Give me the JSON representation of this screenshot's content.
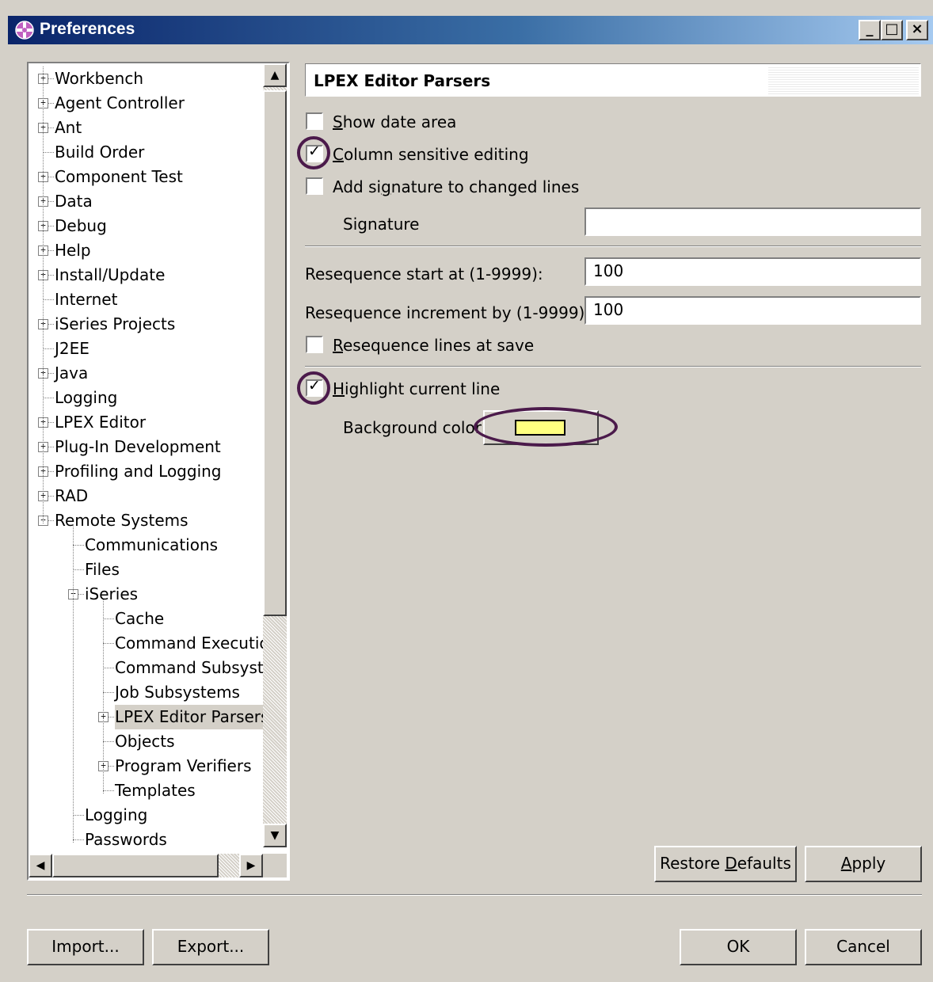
{
  "window": {
    "title": "Preferences",
    "controls": [
      "_",
      "□",
      "×"
    ]
  },
  "tree": {
    "items": [
      {
        "label": "Workbench",
        "expander": "+",
        "level": 0
      },
      {
        "label": "Agent Controller",
        "expander": "+",
        "level": 0
      },
      {
        "label": "Ant",
        "expander": "+",
        "level": 0
      },
      {
        "label": "Build Order",
        "expander": "",
        "level": 0
      },
      {
        "label": "Component Test",
        "expander": "+",
        "level": 0
      },
      {
        "label": "Data",
        "expander": "+",
        "level": 0
      },
      {
        "label": "Debug",
        "expander": "+",
        "level": 0
      },
      {
        "label": "Help",
        "expander": "+",
        "level": 0
      },
      {
        "label": "Install/Update",
        "expander": "+",
        "level": 0
      },
      {
        "label": "Internet",
        "expander": "",
        "level": 0
      },
      {
        "label": "iSeries Projects",
        "expander": "+",
        "level": 0
      },
      {
        "label": "J2EE",
        "expander": "",
        "level": 0
      },
      {
        "label": "Java",
        "expander": "+",
        "level": 0
      },
      {
        "label": "Logging",
        "expander": "",
        "level": 0
      },
      {
        "label": "LPEX Editor",
        "expander": "+",
        "level": 0
      },
      {
        "label": "Plug-In Development",
        "expander": "+",
        "level": 0
      },
      {
        "label": "Profiling and Logging",
        "expander": "+",
        "level": 0
      },
      {
        "label": "RAD",
        "expander": "+",
        "level": 0
      },
      {
        "label": "Remote Systems",
        "expander": "−",
        "level": 0
      },
      {
        "label": "Communications",
        "expander": "",
        "level": 1
      },
      {
        "label": "Files",
        "expander": "",
        "level": 1
      },
      {
        "label": "iSeries",
        "expander": "−",
        "level": 1
      },
      {
        "label": "Cache",
        "expander": "",
        "level": 2
      },
      {
        "label": "Command Executio",
        "expander": "",
        "level": 2
      },
      {
        "label": "Command Subsyste",
        "expander": "",
        "level": 2
      },
      {
        "label": "Job Subsystems",
        "expander": "",
        "level": 2
      },
      {
        "label": "LPEX Editor Parsers",
        "expander": "+",
        "level": 2,
        "selected": true
      },
      {
        "label": "Objects",
        "expander": "",
        "level": 2
      },
      {
        "label": "Program Verifiers",
        "expander": "+",
        "level": 2
      },
      {
        "label": "Templates",
        "expander": "",
        "level": 2
      },
      {
        "label": "Logging",
        "expander": "",
        "level": 1
      },
      {
        "label": "Passwords",
        "expander": "",
        "level": 1
      }
    ]
  },
  "page": {
    "title": "LPEX Editor Parsers",
    "show_date_area": {
      "mnemonic": "S",
      "rest": "how date area",
      "checked": false
    },
    "column_sensitive": {
      "mnemonic": "C",
      "rest": "olumn sensitive editing",
      "checked": true
    },
    "add_signature": {
      "pre": "Add si",
      "mnemonic": "g",
      "rest": "nature to changed lines",
      "checked": false
    },
    "signature_label": "Signature",
    "signature_value": "",
    "reseq_start_label": "Resequence start at (1-9999):",
    "reseq_start_value": "100",
    "reseq_incr_label": "Resequence increment by (1-9999):",
    "reseq_incr_value": "100",
    "reseq_save": {
      "mnemonic": "R",
      "rest": "esequence lines at save",
      "checked": false
    },
    "highlight": {
      "mnemonic": "H",
      "rest": "ighlight current line",
      "checked": true
    },
    "bg_color_label": "Background color",
    "bg_color": "#ffff80",
    "restore_defaults": {
      "pre": "Restore ",
      "mnemonic": "D",
      "rest": "efaults"
    },
    "apply": {
      "mnemonic": "A",
      "rest": "pply"
    }
  },
  "footer": {
    "import": "Import...",
    "export": "Export...",
    "ok": "OK",
    "cancel": "Cancel"
  },
  "colors": {
    "titlebar_start": "#0a246a",
    "titlebar_end": "#a6caf0",
    "annotation_ring": "#4b1a4b",
    "face": "#d4d0c8"
  }
}
